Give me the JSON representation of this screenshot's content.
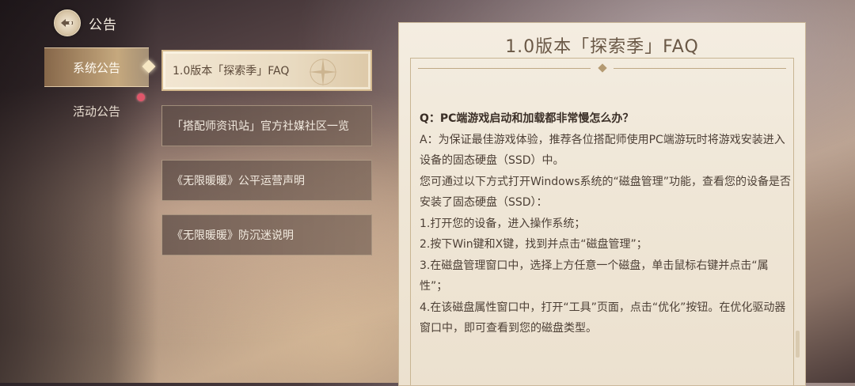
{
  "header": {
    "title": "公告",
    "icon": "back-emblem-icon"
  },
  "sidebar": {
    "tabs": [
      {
        "label": "系统公告",
        "active": true
      },
      {
        "label": "活动公告",
        "active": false,
        "has_notification": true
      }
    ]
  },
  "list": {
    "items": [
      {
        "label": "1.0版本「探索季」FAQ",
        "active": true
      },
      {
        "label": "「搭配师资讯站」官方社媒社区一览",
        "active": false
      },
      {
        "label": "《无限暖暖》公平运营声明",
        "active": false
      },
      {
        "label": "《无限暖暖》防沉迷说明",
        "active": false
      }
    ]
  },
  "article": {
    "title": "1.0版本「探索季」FAQ",
    "question": "Q：PC端游戏启动和加载都非常慢怎么办？",
    "paragraphs": [
      "A：为保证最佳游戏体验，推荐各位搭配师使用PC端游玩时将游戏安装进入设备的固态硬盘（SSD）中。",
      "您可通过以下方式打开Windows系统的“磁盘管理”功能，查看您的设备是否安装了固态硬盘（SSD）：",
      "1.打开您的设备，进入操作系统；",
      "2.按下Win键和X键，找到并点击“磁盘管理”；",
      "3.在磁盘管理窗口中，选择上方任意一个磁盘，单击鼠标右键并点击“属性”；",
      "4.在该磁盘属性窗口中，打开“工具”页面，点击“优化”按钮。在优化驱动器窗口中，即可查看到您的磁盘类型。"
    ]
  },
  "colors": {
    "accent": "#d4b98e",
    "notification": "#e0566a",
    "panel": "#f4ede1"
  }
}
